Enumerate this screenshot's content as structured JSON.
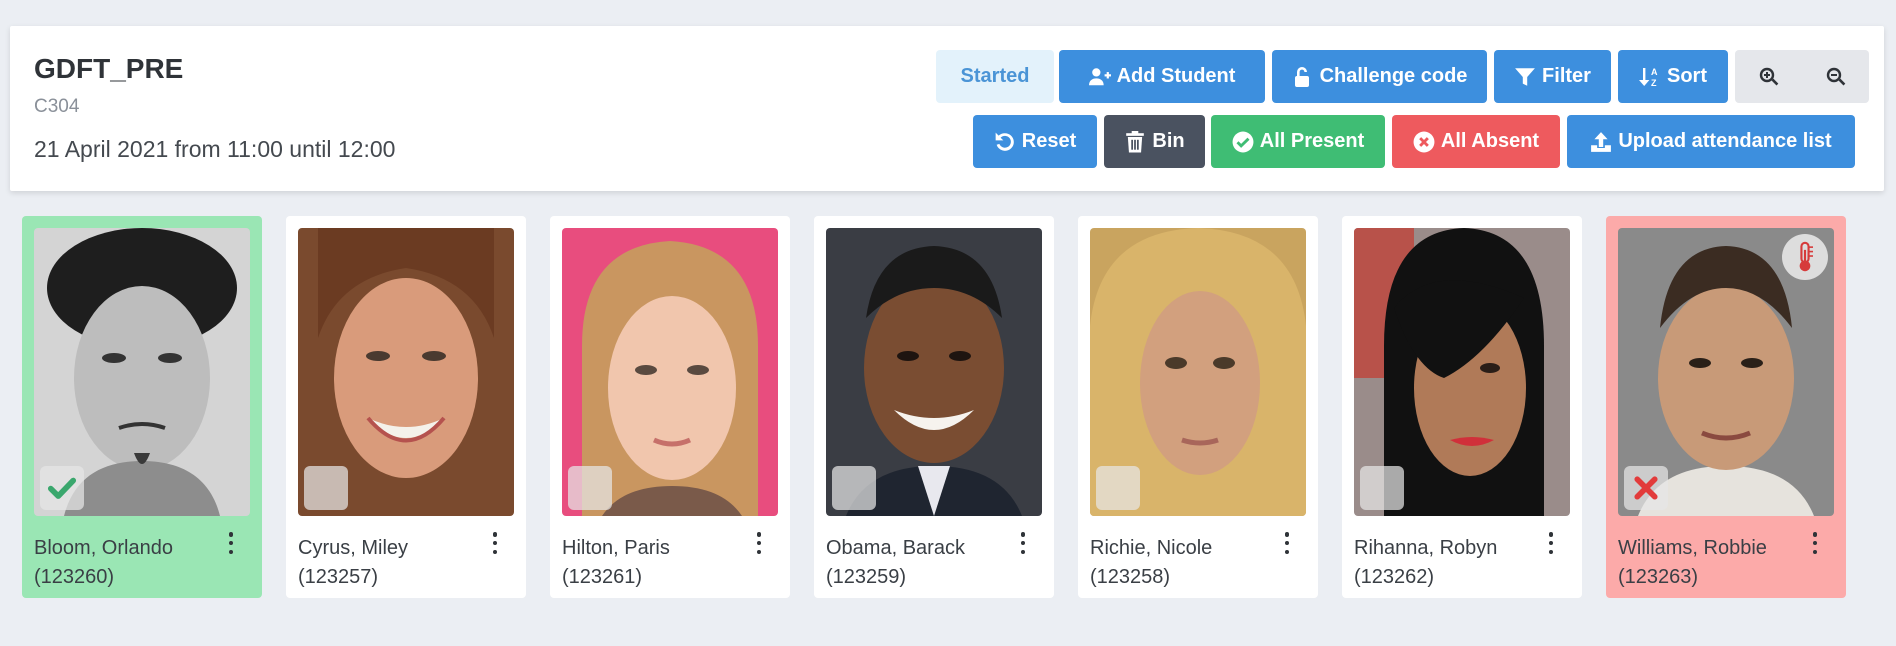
{
  "exam": {
    "code": "GDFT_PRE",
    "room": "C304",
    "schedule": "21 April 2021 from 11:00 until 12:00"
  },
  "toolbar": {
    "status_label": "Started",
    "add_student": "Add Student",
    "challenge_code": "Challenge code",
    "filter": "Filter",
    "sort": "Sort",
    "reset": "Reset",
    "bin": "Bin",
    "all_present": "All Present",
    "all_absent": "All Absent",
    "upload": "Upload attendance list"
  },
  "colors": {
    "present": "#9ae6b4",
    "absent": "#fcaaa9",
    "primary": "#3d8fde",
    "success": "#3fbd74",
    "danger": "#ee5a5e"
  },
  "students": [
    {
      "name": "Bloom, Orlando",
      "id": "(123260)",
      "status": "present"
    },
    {
      "name": "Cyrus, Miley",
      "id": "(123257)",
      "status": "unmarked"
    },
    {
      "name": "Hilton, Paris",
      "id": "(123261)",
      "status": "unmarked"
    },
    {
      "name": "Obama, Barack",
      "id": "(123259)",
      "status": "unmarked"
    },
    {
      "name": "Richie, Nicole",
      "id": "(123258)",
      "status": "unmarked"
    },
    {
      "name": "Rihanna, Robyn",
      "id": "(123262)",
      "status": "unmarked"
    },
    {
      "name": "Williams, Robbie",
      "id": "(123263)",
      "status": "absent",
      "flag": "thermometer-icon"
    }
  ]
}
